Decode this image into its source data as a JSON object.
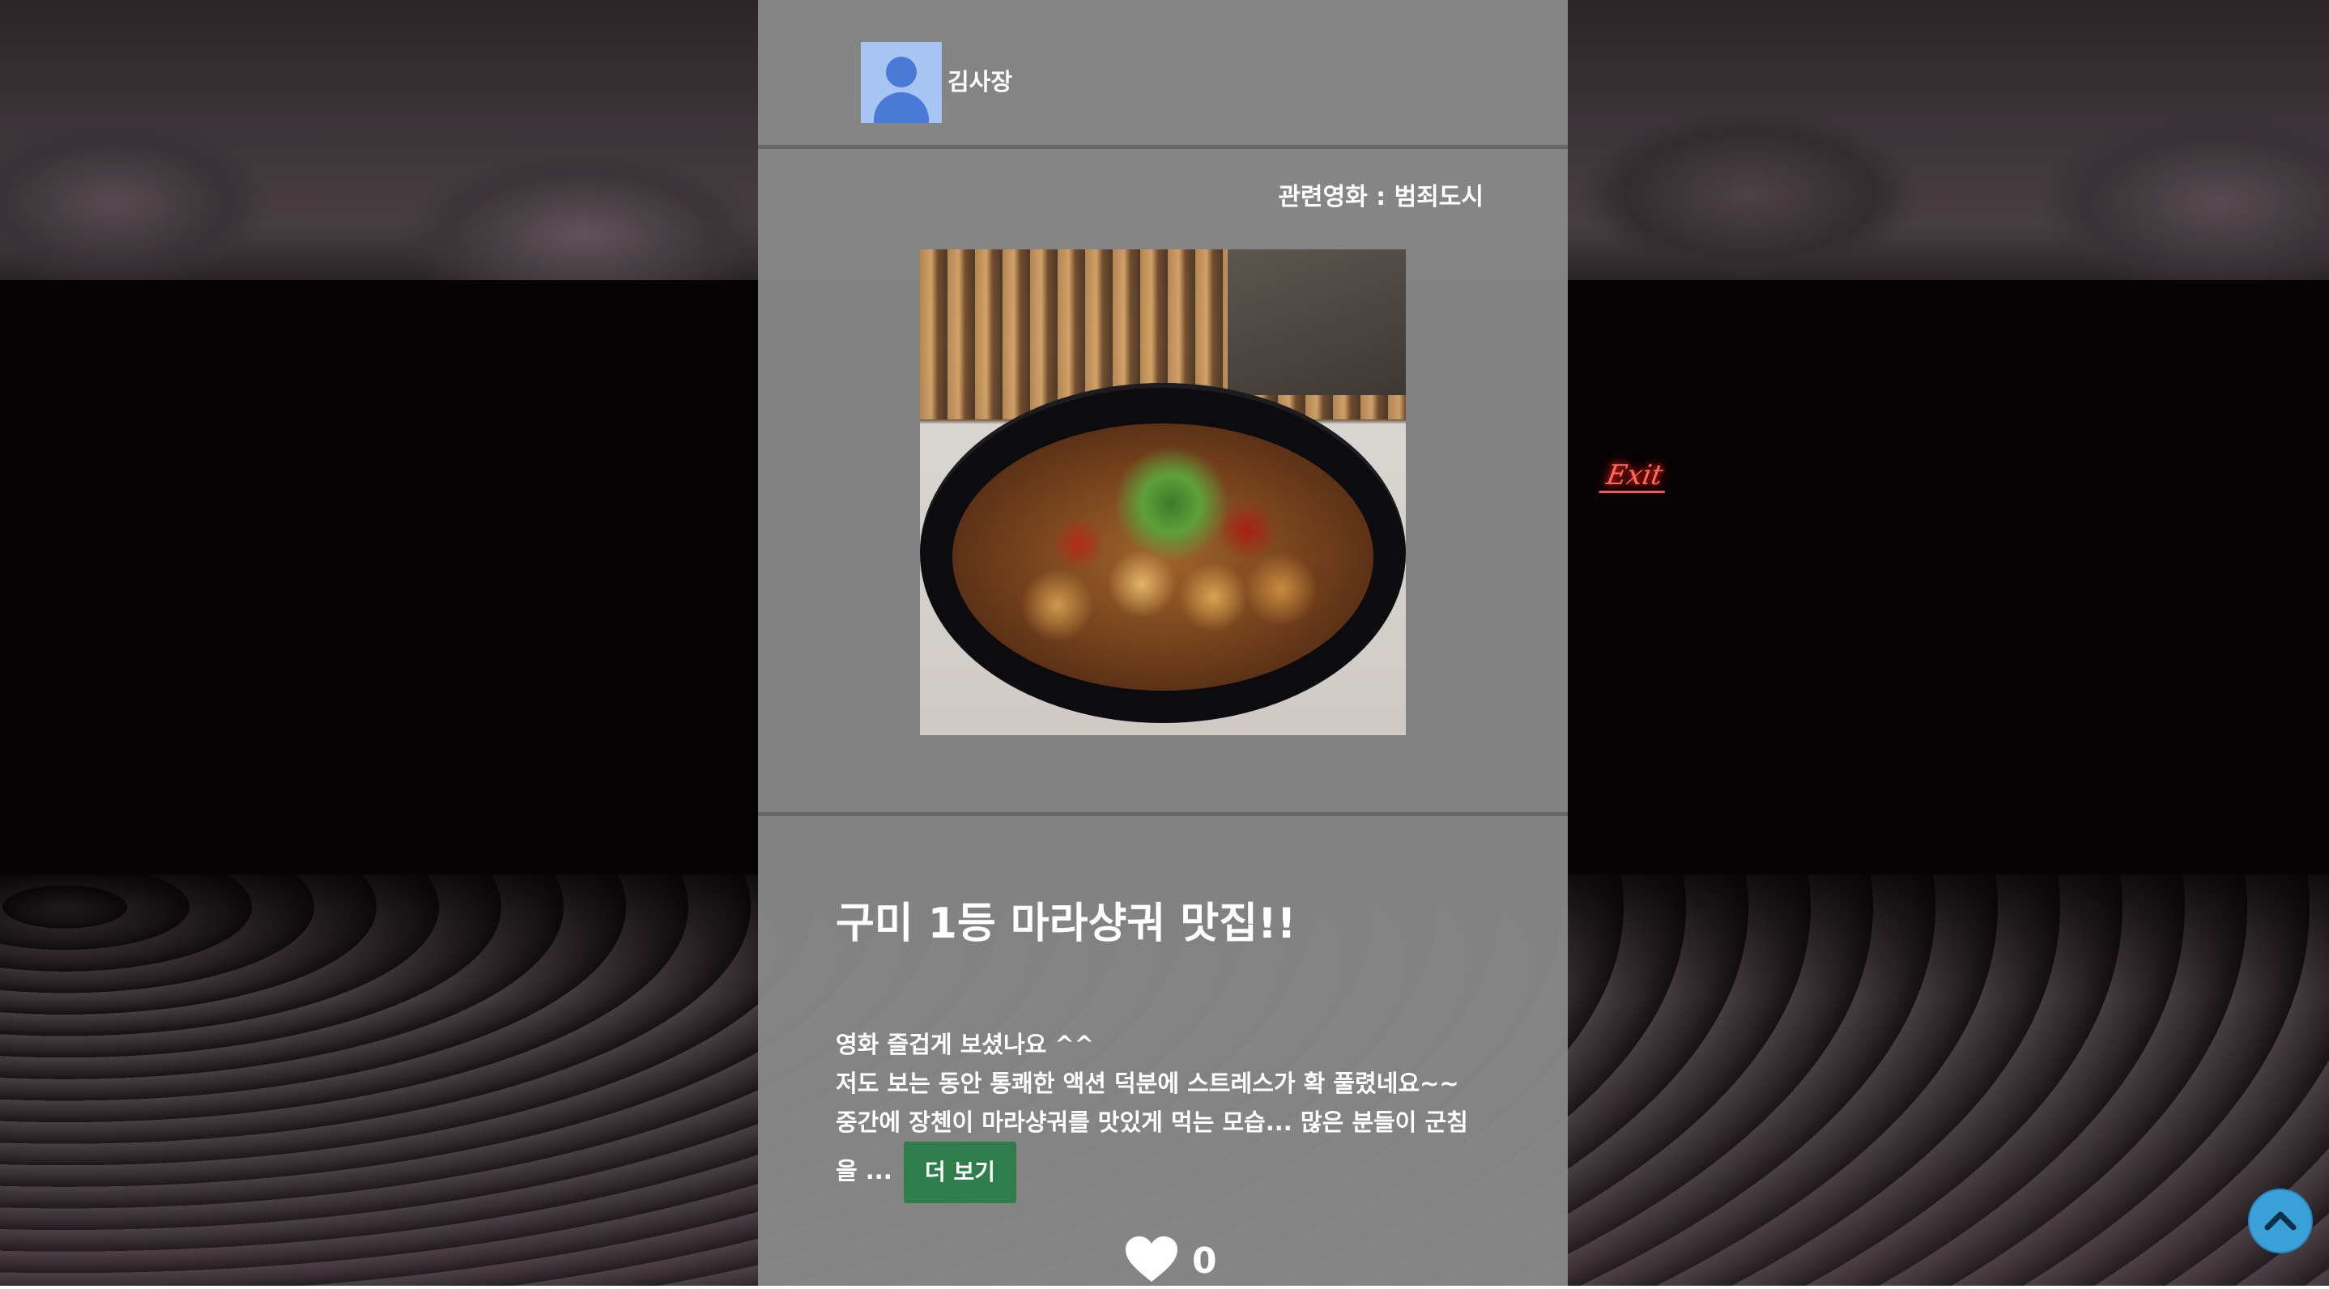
{
  "post": {
    "author": "김사장",
    "related_movie": "관련영화 : 범죄도시",
    "title": "구미 1등 마라샹궈 맛집!!",
    "content_lines": [
      "영화 즐겁게 보셨나요 ^^",
      "저도 보는 동안 통쾌한 액션 덕분에 스트레스가 확 풀렸네요~~",
      "중간에 장첸이 마라샹궈를 맛있게 먹는 모습... 많은 분들이 군침",
      "을 ..."
    ],
    "more_label": "더 보기",
    "like_count": "0"
  },
  "background": {
    "exit_sign": "Exit"
  },
  "icons": {
    "avatar": "user-avatar-icon",
    "like": "heart-icon",
    "scroll_top": "chevron-up-icon"
  },
  "colors": {
    "panel": "#8c8c8c",
    "more_button": "#2e7d4a",
    "scroll_top_button": "#3aa0d8",
    "avatar_bg": "#a8c4f2",
    "avatar_fg": "#4b79d8"
  }
}
